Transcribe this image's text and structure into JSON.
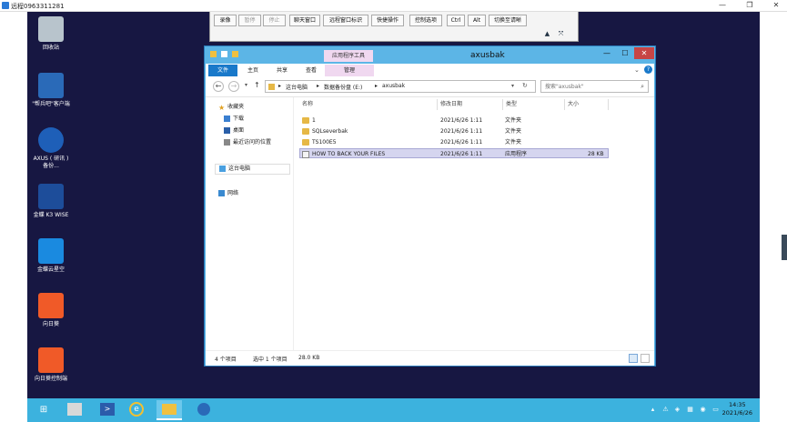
{
  "window": {
    "title": "远程0963311281",
    "controls": [
      "—",
      "❐",
      "✕"
    ]
  },
  "remote_toolbar": {
    "buttons": [
      {
        "label": "录像",
        "enabled": true
      },
      {
        "label": "暂停",
        "enabled": false
      },
      {
        "label": "停止",
        "enabled": false
      },
      {
        "label": "聊天窗口",
        "enabled": true
      },
      {
        "label": "远程窗口标识",
        "enabled": true
      },
      {
        "label": "快捷操作",
        "enabled": true
      },
      {
        "label": "控制选项",
        "enabled": true
      },
      {
        "label": "Ctrl",
        "enabled": true
      },
      {
        "label": "Alt",
        "enabled": true
      },
      {
        "label": "切换至请晰",
        "enabled": true
      }
    ],
    "icons": [
      "pin-icon",
      "expand-icon"
    ]
  },
  "desktop_icons": [
    {
      "label": "回收站",
      "icon": "recycle-bin-icon",
      "color": "#b8c4cc"
    },
    {
      "label": "\"帮兵吧\"客户端",
      "icon": "client-icon",
      "color": "#2a6ab8"
    },
    {
      "label": "AXUS ( 研讯 ) 备份...",
      "icon": "database-icon",
      "color": "#1e5fb8"
    },
    {
      "label": "金蝶 K3 WISE",
      "icon": "k3-icon",
      "color": "#1d4d9a"
    },
    {
      "label": "金蝶云星空",
      "icon": "kingdee-cloud-icon",
      "color": "#1a8ae0"
    },
    {
      "label": "向日葵",
      "icon": "sunflower-icon",
      "color": "#f05a28"
    },
    {
      "label": "向日葵控制端",
      "icon": "sunflower-control-icon",
      "color": "#f05a28"
    }
  ],
  "explorer": {
    "title": "axusbak",
    "context_tab": "应用程序工具",
    "window_controls": [
      "—",
      "☐",
      "✕"
    ],
    "ribbon_tabs": [
      "文件",
      "主页",
      "共享",
      "查看",
      "管理"
    ],
    "breadcrumbs": [
      "这台电脑",
      "数据备份盘 (E:)",
      "axusbak"
    ],
    "search_placeholder": "搜索\"axusbak\"",
    "nav": [
      {
        "label": "收藏夹",
        "icon": "star-icon"
      },
      {
        "label": "下载",
        "icon": "download-folder-icon"
      },
      {
        "label": "桌面",
        "icon": "desktop-folder-icon"
      },
      {
        "label": "最近访问的位置",
        "icon": "recent-places-icon"
      },
      {
        "label": "这台电脑",
        "icon": "computer-icon"
      },
      {
        "label": "网络",
        "icon": "network-icon"
      }
    ],
    "columns": [
      "名称",
      "修改日期",
      "类型",
      "大小"
    ],
    "files": [
      {
        "name": "1",
        "date": "2021/6/26 1:11",
        "type": "文件夹",
        "size": "",
        "kind": "folder"
      },
      {
        "name": "SQLseverbak",
        "date": "2021/6/26 1:11",
        "type": "文件夹",
        "size": "",
        "kind": "folder"
      },
      {
        "name": "TS100E5",
        "date": "2021/6/26 1:11",
        "type": "文件夹",
        "size": "",
        "kind": "folder"
      },
      {
        "name": "HOW TO BACK YOUR FILES",
        "date": "2021/6/26 1:11",
        "type": "应用程序",
        "size": "28 KB",
        "kind": "app"
      }
    ],
    "status": {
      "count": "4 个项目",
      "selected": "选中 1 个项目",
      "size": "28.0 KB"
    }
  },
  "taskbar": {
    "clock_time": "14:35",
    "clock_date": "2021/6/26"
  }
}
